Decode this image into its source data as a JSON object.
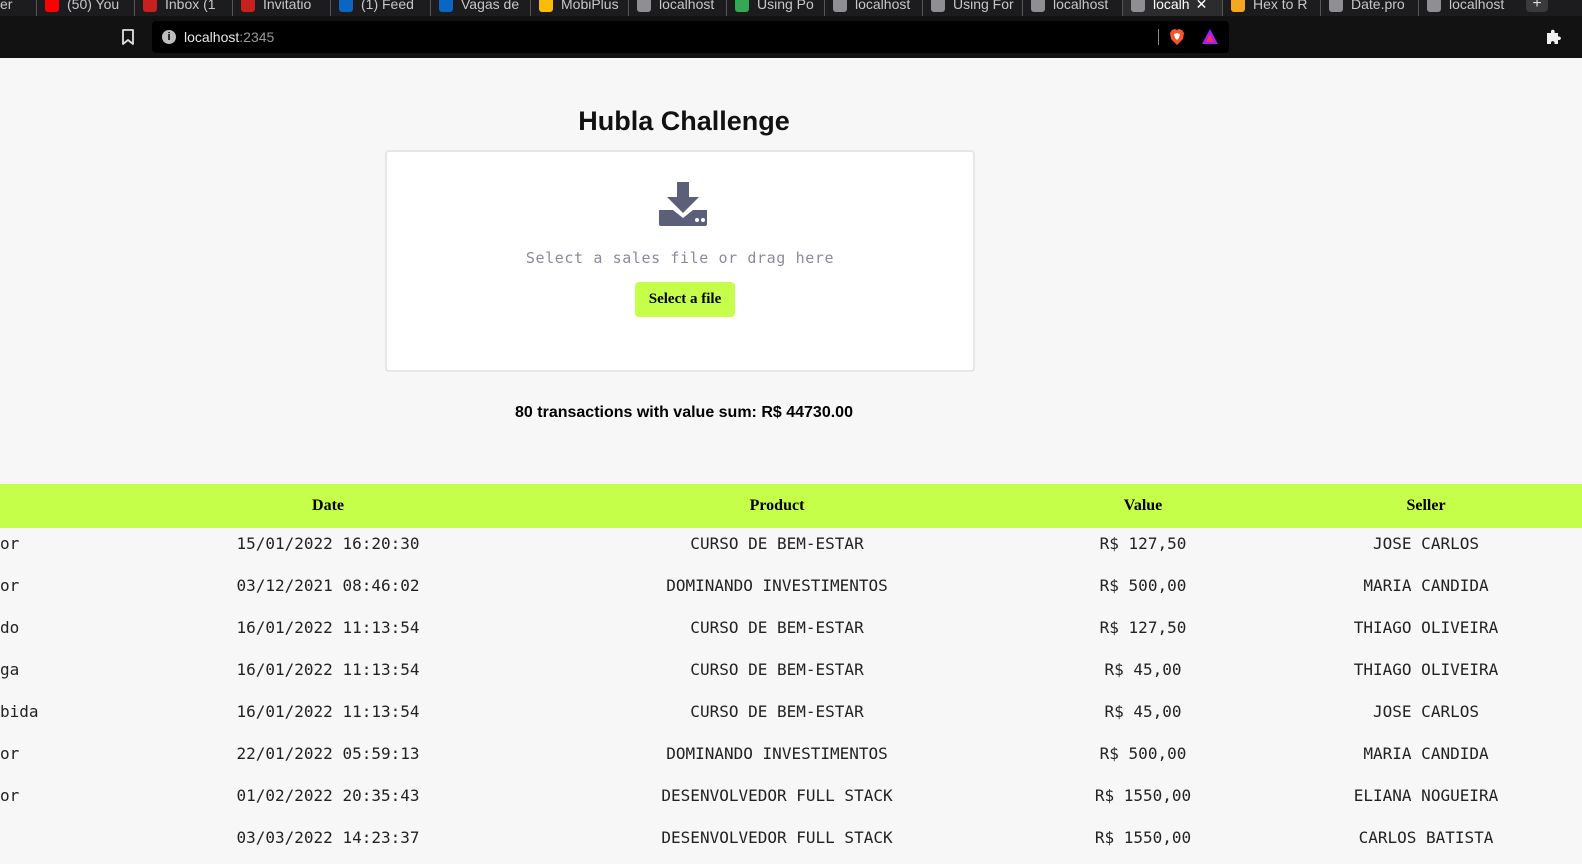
{
  "browser": {
    "tabs": [
      {
        "label": "er",
        "favicon": "none"
      },
      {
        "label": "(50) You",
        "favicon": "youtube-icon",
        "color": "#ff0000"
      },
      {
        "label": "Inbox (1",
        "favicon": "gmail-icon",
        "color": "#c5221f"
      },
      {
        "label": "Invitatio",
        "favicon": "gmail-icon",
        "color": "#c5221f"
      },
      {
        "label": "(1) Feed",
        "favicon": "linkedin-icon",
        "color": "#0a66c2"
      },
      {
        "label": "Vagas de",
        "favicon": "linkedin-icon",
        "color": "#0a66c2"
      },
      {
        "label": "MobiPlus",
        "favicon": "drive-icon",
        "color": "#fbbc04"
      },
      {
        "label": "localhost",
        "favicon": "globe-icon",
        "color": "#8e8e93"
      },
      {
        "label": "Using Po",
        "favicon": "chrome-icon",
        "color": "#34a853"
      },
      {
        "label": "localhost",
        "favicon": "globe-icon",
        "color": "#8e8e93"
      },
      {
        "label": "Using For",
        "favicon": "medium-icon",
        "color": "#8e8e93"
      },
      {
        "label": "localhost",
        "favicon": "globe-icon",
        "color": "#8e8e93"
      },
      {
        "label": "localh",
        "favicon": "globe-icon",
        "color": "#8e8e93",
        "active": true
      },
      {
        "label": "Hex to R",
        "favicon": "rgb-icon",
        "color": "#f5a623"
      },
      {
        "label": "Date.pro",
        "favicon": "medium-icon",
        "color": "#8e8e93"
      },
      {
        "label": "localhost",
        "favicon": "globe-icon",
        "color": "#8e8e93"
      }
    ],
    "tab_close": "✕",
    "new_tab": "+",
    "url_host": "localhost",
    "url_port": ":2345"
  },
  "page": {
    "title": "Hubla Challenge",
    "upload_hint": "Select a sales file or drag here",
    "select_button": "Select a file",
    "summary": "80 transactions with value sum: R$ 44730.00"
  },
  "colors": {
    "accent": "#c6ff4a",
    "icon": "#5c5f7a"
  },
  "table": {
    "headers": {
      "date": "Date",
      "product": "Product",
      "value": "Value",
      "seller": "Seller"
    },
    "rows": [
      {
        "type": "or",
        "date": "15/01/2022 16:20:30",
        "product": "CURSO DE BEM-ESTAR",
        "value": "R$ 127,50",
        "seller": "JOSE CARLOS"
      },
      {
        "type": "or",
        "date": "03/12/2021 08:46:02",
        "product": "DOMINANDO INVESTIMENTOS",
        "value": "R$ 500,00",
        "seller": "MARIA CANDIDA"
      },
      {
        "type": "do",
        "date": "16/01/2022 11:13:54",
        "product": "CURSO DE BEM-ESTAR",
        "value": "R$ 127,50",
        "seller": "THIAGO OLIVEIRA"
      },
      {
        "type": "ga",
        "date": "16/01/2022 11:13:54",
        "product": "CURSO DE BEM-ESTAR",
        "value": "R$ 45,00",
        "seller": "THIAGO OLIVEIRA"
      },
      {
        "type": "bida",
        "date": "16/01/2022 11:13:54",
        "product": "CURSO DE BEM-ESTAR",
        "value": "R$ 45,00",
        "seller": "JOSE CARLOS"
      },
      {
        "type": "or",
        "date": "22/01/2022 05:59:13",
        "product": "DOMINANDO INVESTIMENTOS",
        "value": "R$ 500,00",
        "seller": "MARIA CANDIDA"
      },
      {
        "type": "or",
        "date": "01/02/2022 20:35:43",
        "product": "DESENVOLVEDOR FULL STACK",
        "value": "R$ 1550,00",
        "seller": "ELIANA NOGUEIRA"
      },
      {
        "type": "",
        "date": "03/03/2022 14:23:37",
        "product": "DESENVOLVEDOR FULL STACK",
        "value": "R$ 1550,00",
        "seller": "CARLOS BATISTA"
      }
    ]
  }
}
